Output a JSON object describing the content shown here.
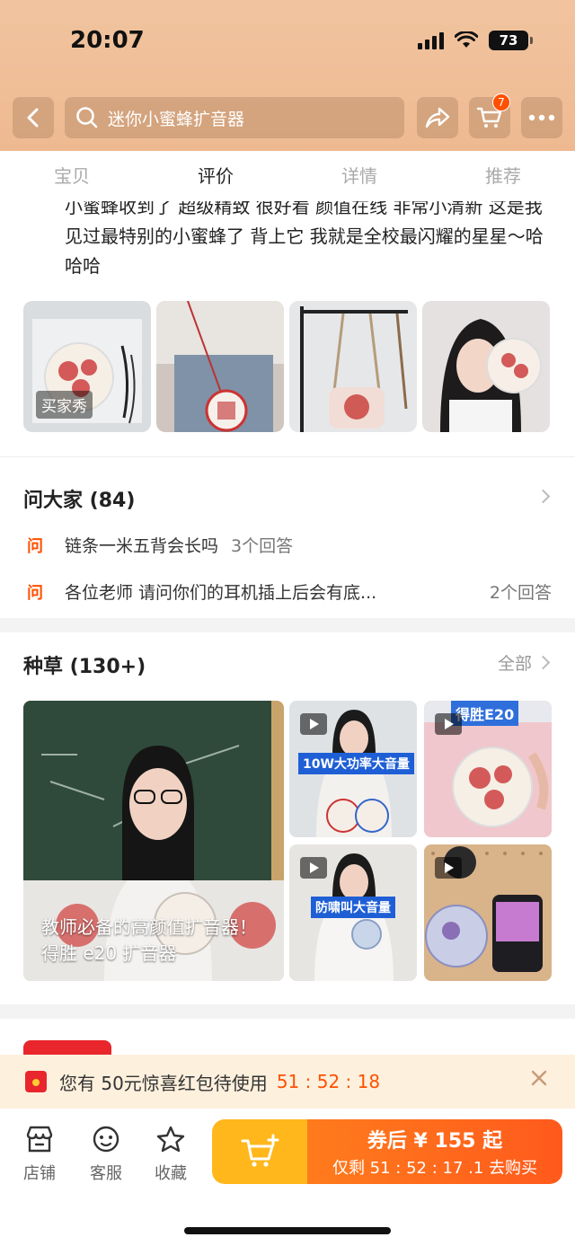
{
  "status": {
    "time": "20:07",
    "battery": "73"
  },
  "search": {
    "query": "迷你小蜜蜂扩音器"
  },
  "cart": {
    "badge": "7"
  },
  "tabs": [
    {
      "label": "宝贝"
    },
    {
      "label": "评价"
    },
    {
      "label": "详情"
    },
    {
      "label": "推荐"
    }
  ],
  "review": {
    "text": "小蜜蜂收到了 超级精致 很好看 颜值在线 非常小清新 这是我见过最特别的小蜜蜂了 背上它 我就是全校最闪耀的星星～哈哈哈",
    "photo_tag": "买家秀"
  },
  "ask": {
    "title": "问大家 (84)",
    "mark": "问",
    "questions": [
      {
        "text": "链条一米五背会长吗",
        "answers": "3个回答"
      },
      {
        "text": "各位老师 请问你们的耳机插上后会有底...",
        "answers": "2个回答"
      }
    ]
  },
  "grass": {
    "title": "种草 (130+)",
    "all_label": "全部",
    "main_caption": "教师必备的高颜值扩音器！得胜 e20 扩音器",
    "video_labels": [
      "10W大功率大音量",
      "得胜E20",
      "防啸叫大音量"
    ]
  },
  "coupon": {
    "text": "您有 50元惊喜红包待使用",
    "timer": "51 : 52 : 18"
  },
  "bottom": {
    "shop": "店铺",
    "service": "客服",
    "favorite": "收藏",
    "buy_main": "券后 ¥ 155 起",
    "buy_sub": "仅剩 51 : 52 : 17 .1 去购买"
  },
  "colors": {
    "accent": "#ff5000",
    "header": "#f0bf98",
    "buy_yellow": "#ffb71c",
    "buy_orange": "#ff6a1c"
  }
}
